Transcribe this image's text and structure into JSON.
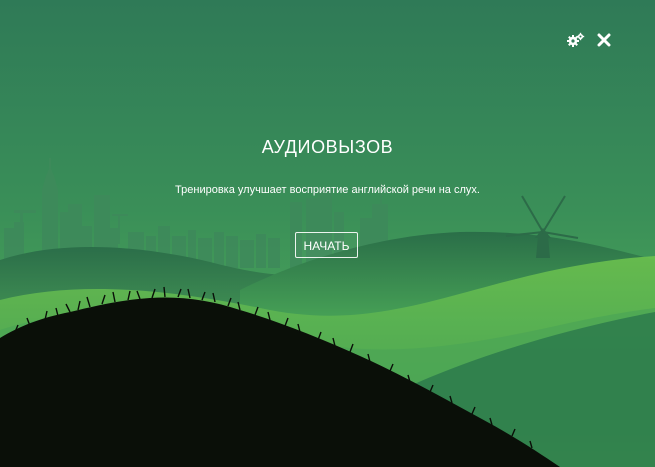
{
  "window": {
    "settings_icon": "gears-icon",
    "close_icon": "close-icon"
  },
  "game": {
    "title": "АУДИОВЫЗОВ",
    "subtitle": "Тренировка улучшает восприятие английской речи на слух.",
    "start_label": "НАЧАТЬ"
  },
  "colors": {
    "sky_top": "#2f7a57",
    "sky_bottom": "#3f9a5a",
    "hill_light": "#67c04e",
    "foreground": "#0a0f08",
    "text": "#ffffff"
  }
}
